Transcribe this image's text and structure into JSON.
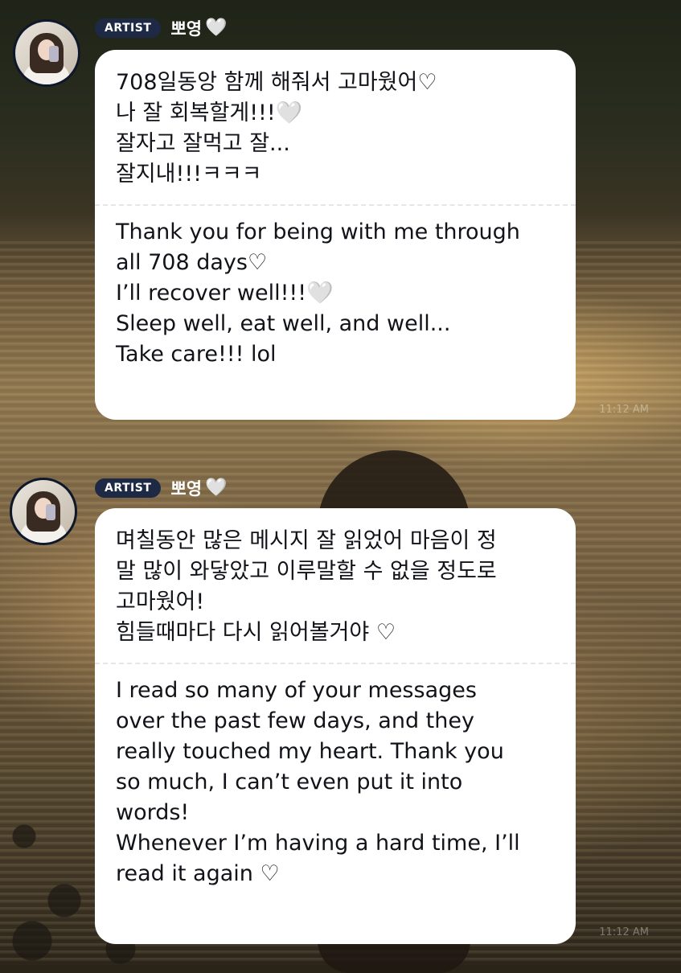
{
  "messages": [
    {
      "badge": "ARTIST",
      "name": "뽀영",
      "name_heart": "🤍",
      "korean_lines": [
        "708일동앙 함께 해줘서 고마웠어♡",
        "나 잘 회복할게!!!🤍",
        "잘자고 잘먹고 잘...",
        "잘지내!!!ㅋㅋㅋ"
      ],
      "english_lines": [
        "Thank you for being with me through",
        "all 708 days♡",
        "I’ll recover well!!!🤍",
        "Sleep well, eat well, and well...",
        "Take care!!! lol"
      ],
      "timestamp": "11:12 AM"
    },
    {
      "badge": "ARTIST",
      "name": "뽀영",
      "name_heart": "🤍",
      "korean_lines": [
        "며칠동안 많은 메시지 잘 읽었어 마음이 정",
        "말 많이 와닿았고 이루말할 수 없을 정도로",
        "고마웠어!",
        "힘들때마다 다시 읽어볼거야 ♡"
      ],
      "english_lines": [
        "I read so many of your messages",
        "over the past few days, and they",
        "really touched my heart. Thank you",
        "so much, I can’t even put it into",
        "words!",
        "Whenever I’m having a hard time, I’ll",
        "read it again ♡"
      ],
      "timestamp": "11:12 AM"
    }
  ],
  "colors": {
    "badge_bg": "#1e2a45",
    "bubble_bg": "#ffffff",
    "text": "#111318"
  }
}
